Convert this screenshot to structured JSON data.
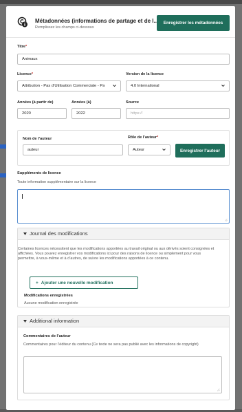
{
  "header": {
    "title": "Métadonnées (informations de partage et de l...",
    "subtitle": "Remplissez les champs ci-dessous",
    "save_button": "Enregistrer les métadonnées",
    "icon": "info-copyright-icon"
  },
  "form": {
    "title_label": "Titre",
    "title_value": "Animaux",
    "license_label": "Licence",
    "license_value": "Attribution - Pas d’Utilisation Commerciale - Pa",
    "license_version_label": "Version de la licence",
    "license_version_value": "4.0 International",
    "year_from_label": "Années (à partir de)",
    "year_from_value": "2020",
    "year_to_label": "Années (à)",
    "year_to_value": "2022",
    "source_label": "Source",
    "source_placeholder": "https://",
    "author_name_label": "Nom de l’auteur",
    "author_name_value": "auteur",
    "author_role_label": "Rôle de l’auteur",
    "author_role_value": "Auteur",
    "save_author_button": "Enregistrer l’auteur",
    "required_mark": "*"
  },
  "license_extras": {
    "label": "Suppléments de licence",
    "help": "Toute information supplémentaire sur la licence",
    "value": ""
  },
  "changes_panel": {
    "title": "Journal des modifications",
    "description": "Certaines licences nécessitent que les modifications apportées au travail original ou aux dérivés soient consignées et affichées. Vous pouvez enregistrer vos modifications ici pour des raisons de licence ou simplement pour vous permettre, à vous-même et à d’autres, de suivre les modifications apportées à ce contenu.",
    "add_button": "Ajouter une nouvelle modification",
    "saved_label": "Modifications enregistrées",
    "saved_empty": "Aucune modification enregistrée"
  },
  "additional_panel": {
    "title": "Additional information",
    "comments_label": "Commentaires de l’auteur",
    "comments_help": "Commentaires pour l’éditeur du contenu (Ce texte ne sera pas publié avec les informations de copyright)",
    "comments_value": ""
  },
  "colors": {
    "primary": "#1f6e5b",
    "required": "#c0261f",
    "focus": "#5a8fd0"
  }
}
